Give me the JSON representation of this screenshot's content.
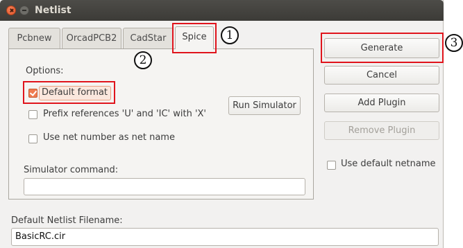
{
  "window": {
    "title": "Netlist"
  },
  "tabs": [
    {
      "label": "Pcbnew",
      "active": false
    },
    {
      "label": "OrcadPCB2",
      "active": false
    },
    {
      "label": "CadStar",
      "active": false
    },
    {
      "label": "Spice",
      "active": true
    }
  ],
  "options": {
    "heading": "Options:",
    "default_format": {
      "label": "Default format",
      "checked": true
    },
    "prefix_refs": {
      "label": "Prefix references 'U' and 'IC' with 'X'",
      "checked": false
    },
    "net_number": {
      "label": "Use net number as net name",
      "checked": false
    },
    "run_simulator_label": "Run Simulator"
  },
  "simulator": {
    "label": "Simulator command:",
    "value": ""
  },
  "buttons": {
    "generate": "Generate",
    "cancel": "Cancel",
    "add_plugin": "Add Plugin",
    "remove_plugin": "Remove Plugin"
  },
  "use_default_netname": {
    "label": "Use default netname",
    "checked": false
  },
  "filename": {
    "label": "Default Netlist Filename:",
    "value": "BasicRC.cir"
  },
  "annotations": [
    "1",
    "2",
    "3"
  ],
  "colors": {
    "annotation_red": "#e0141c",
    "checkbox_orange": "#ef7b4f"
  }
}
